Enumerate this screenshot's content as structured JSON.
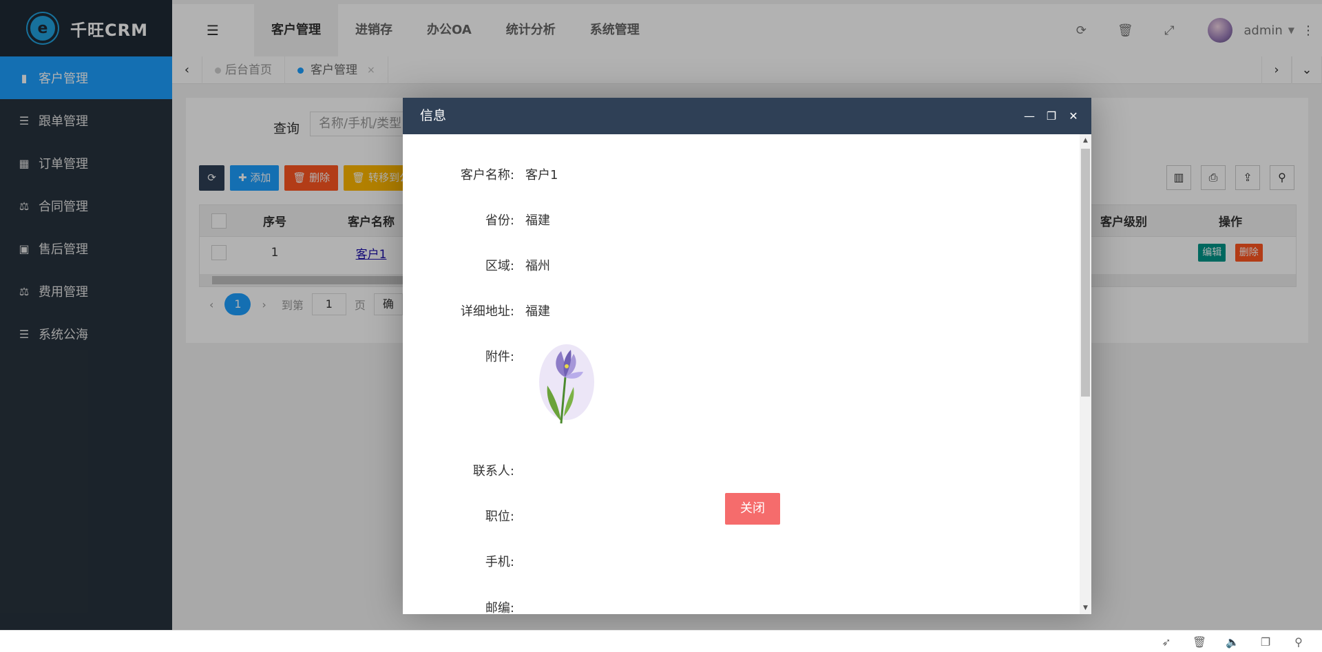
{
  "brand": {
    "logo_letter": "e",
    "name": "千旺CRM"
  },
  "sidebar": {
    "items": [
      {
        "label": "客户管理",
        "icon": "▮"
      },
      {
        "label": "跟单管理",
        "icon": "☰"
      },
      {
        "label": "订单管理",
        "icon": "▦"
      },
      {
        "label": "合同管理",
        "icon": "⚖"
      },
      {
        "label": "售后管理",
        "icon": "▣"
      },
      {
        "label": "费用管理",
        "icon": "⚖"
      },
      {
        "label": "系统公海",
        "icon": "☰"
      }
    ]
  },
  "header": {
    "tabs": [
      "客户管理",
      "进销存",
      "办公OA",
      "统计分析",
      "系统管理"
    ],
    "user": "admin"
  },
  "page_tabs": {
    "items": [
      "后台首页",
      "客户管理"
    ],
    "close_icon": "×"
  },
  "content": {
    "query_label": "查询",
    "query_placeholder": "名称/手机/类型",
    "toolbar": {
      "add": "✚ 添加",
      "delete": "🗑 删除",
      "move": "🗑 转移到公"
    },
    "table": {
      "headers": [
        "序号",
        "客户名称",
        "客户级别",
        "操作"
      ],
      "rows": [
        {
          "index": "1",
          "name": "客户1",
          "edit": "编辑",
          "delete": "删除"
        }
      ]
    },
    "pager": {
      "page": "1",
      "goto_label": "到第",
      "goto_value": "1",
      "page_unit": "页",
      "confirm": "确"
    }
  },
  "modal": {
    "title": "信息",
    "fields": [
      {
        "label": "客户名称:",
        "value": "客户1"
      },
      {
        "label": "省份:",
        "value": "福建"
      },
      {
        "label": "区域:",
        "value": "福州"
      },
      {
        "label": "详细地址:",
        "value": "福建"
      },
      {
        "label": "附件:",
        "value": ""
      },
      {
        "label": "联系人:",
        "value": ""
      },
      {
        "label": "职位:",
        "value": ""
      },
      {
        "label": "手机:",
        "value": ""
      },
      {
        "label": "邮编:",
        "value": ""
      }
    ],
    "close_label": "关闭"
  },
  "colors": {
    "sidebar": "#28333e",
    "accent": "#1e9fff",
    "modal_title": "#2f4056",
    "close_btn": "#f56c6c"
  }
}
